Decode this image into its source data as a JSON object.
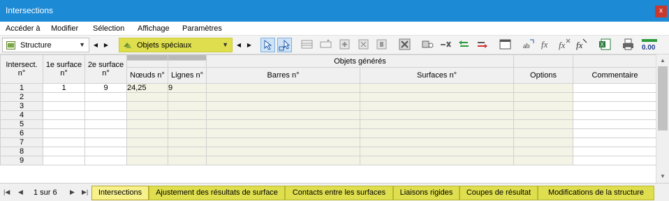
{
  "window": {
    "title": "Intersections",
    "close_label": "x"
  },
  "menu": [
    "Accéder à",
    "Modifier",
    "Sélection",
    "Affichage",
    "Paramètres"
  ],
  "toolbar": {
    "combo1": {
      "label": "Structure"
    },
    "combo2": {
      "label": "Objets spéciaux"
    },
    "zoom_label": "0.00"
  },
  "table": {
    "headers": {
      "intersect": [
        "Intersect.",
        "n°"
      ],
      "surf1": [
        "1e surface",
        "n°"
      ],
      "surf2": [
        "2e surface",
        "n°"
      ],
      "group": "Objets générés",
      "nodes": "Nœuds n°",
      "lines": "Lignes n°",
      "bars": "Barres n°",
      "surfaces": "Surfaces n°",
      "options": "Options",
      "comment": "Commentaire"
    },
    "rows": [
      {
        "no": "1",
        "s1": "1",
        "s2": "9",
        "nodes": "24,25",
        "lines": "9"
      },
      {
        "no": "2",
        "s1": "",
        "s2": "",
        "nodes": "",
        "lines": ""
      },
      {
        "no": "3",
        "s1": "",
        "s2": "",
        "nodes": "",
        "lines": ""
      },
      {
        "no": "4",
        "s1": "",
        "s2": "",
        "nodes": "",
        "lines": ""
      },
      {
        "no": "5",
        "s1": "",
        "s2": "",
        "nodes": "",
        "lines": ""
      },
      {
        "no": "6",
        "s1": "",
        "s2": "",
        "nodes": "",
        "lines": ""
      },
      {
        "no": "7",
        "s1": "",
        "s2": "",
        "nodes": "",
        "lines": ""
      },
      {
        "no": "8",
        "s1": "",
        "s2": "",
        "nodes": "",
        "lines": ""
      },
      {
        "no": "9",
        "s1": "",
        "s2": "",
        "nodes": "",
        "lines": ""
      }
    ]
  },
  "status": {
    "pager": "1 sur 6",
    "tabs": [
      "Intersections",
      "Ajustement des résultats de surface",
      "Contacts entre les surfaces",
      "Liaisons rigides",
      "Coupes de résultat",
      "Modifications de la structure"
    ]
  },
  "colors": {
    "title_bar": "#1d8ad6",
    "tab_yellow": "#dede4f",
    "close": "#c8382c"
  }
}
